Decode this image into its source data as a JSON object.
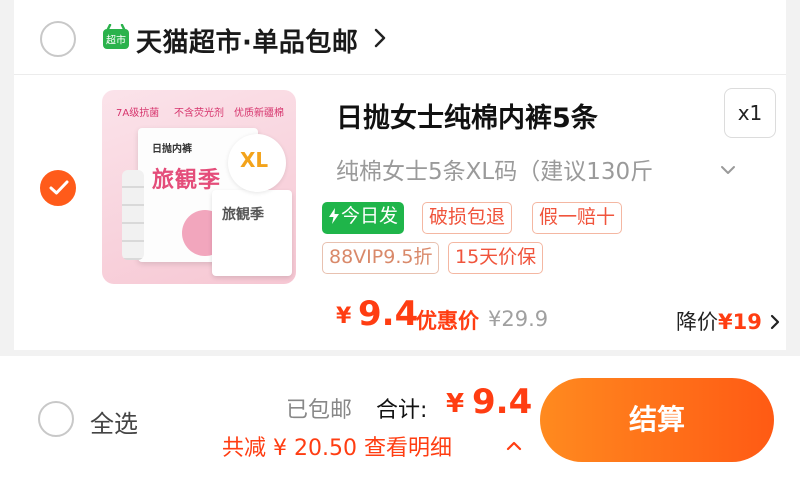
{
  "store": {
    "icon_text": "超市",
    "name": "天猫超市·单品包邮"
  },
  "item": {
    "checked": true,
    "image_tags": [
      "7A级抗菌",
      "不含荧光剂",
      "优质新疆棉"
    ],
    "image_pack_title": "日抛内裤",
    "image_brand": "旅観季",
    "image_size": "XL",
    "title": "日抛女士纯棉内裤5条",
    "quantity": "x1",
    "sku": "纯棉女士5条XL码（建议130斤",
    "badges": {
      "ship_today": "今日发",
      "damage": "破损包退",
      "fake": "假一赔十",
      "vip": "88VIP9.5折",
      "price_protect": "15天价保"
    },
    "price_symbol": "¥",
    "price": "9.4",
    "price_label": "优惠价",
    "original_price": "¥29.9",
    "drop_label": "降价",
    "drop_amount": "¥19"
  },
  "footer": {
    "select_all": "全选",
    "shipping": "已包邮",
    "total_label": "合计:",
    "total_symbol": "¥",
    "total": "9.4",
    "discount_text": "共减 ¥ 20.50  查看明细",
    "checkout": "结算"
  },
  "colors": {
    "accent": "#ff5b1a",
    "price": "#ff3d12",
    "green_badge": "#1fb54a",
    "checkout_start": "#ff8a1f",
    "checkout_end": "#ff5a14"
  }
}
